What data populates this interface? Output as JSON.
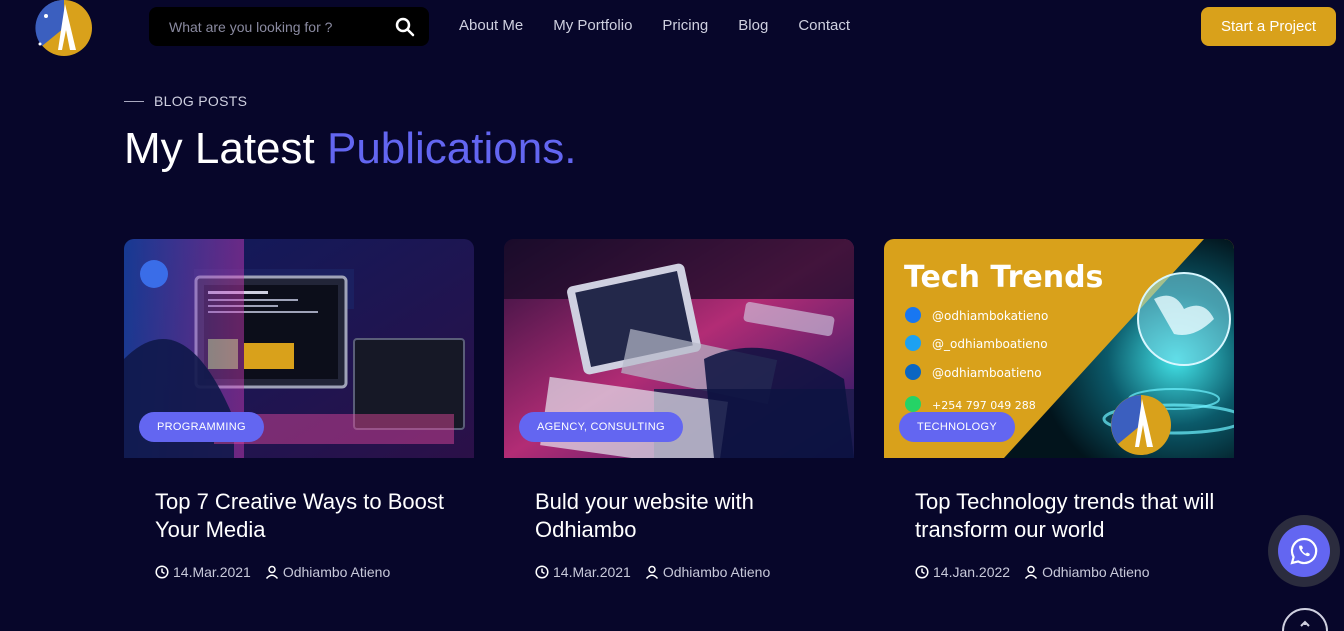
{
  "header": {
    "search": {
      "placeholder": "What are you looking for ?"
    },
    "nav": [
      "About Me",
      "My Portfolio",
      "Pricing",
      "Blog",
      "Contact"
    ],
    "cta_label": "Start a Project"
  },
  "section": {
    "eyebrow": "BLOG POSTS",
    "title_main": "My Latest ",
    "title_accent": "Publications."
  },
  "posts": [
    {
      "tag": "PROGRAMMING",
      "title": "Top 7 Creative Ways to Boost Your Media",
      "date": "14.Mar.2021",
      "author": "Odhiambo Atieno"
    },
    {
      "tag": "AGENCY, CONSULTING",
      "title": "Buld your website with Odhiambo",
      "date": "14.Mar.2021",
      "author": "Odhiambo Atieno"
    },
    {
      "tag": "TECHNOLOGY",
      "title": "Top Technology trends that will transform our world",
      "date": "14.Jan.2022",
      "author": "Odhiambo Atieno"
    }
  ],
  "promo_image": {
    "heading": "Tech Trends",
    "lines": [
      "@odhiambokatieno",
      "@_odhiamboatieno",
      "@odhiamboatieno",
      "+254 797 049 288"
    ]
  },
  "colors": {
    "background": "#07062a",
    "accent": "#6366f1",
    "cta": "#d9a11b"
  },
  "icons": {
    "search": "search-icon",
    "clock": "clock-icon",
    "user": "user-icon",
    "whatsapp": "whatsapp-icon",
    "scroll": "arrow-up-icon"
  }
}
